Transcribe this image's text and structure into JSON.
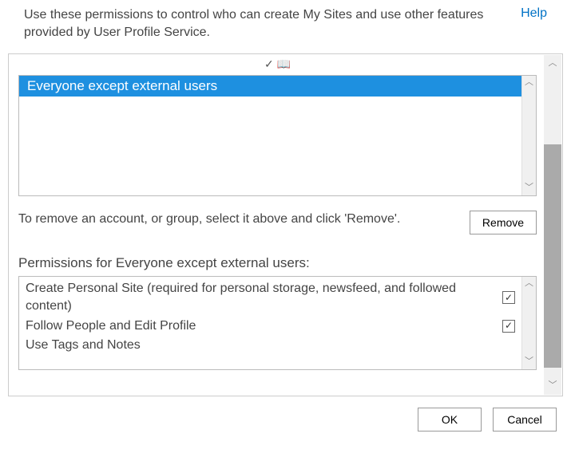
{
  "header": {
    "description": "Use these permissions to control who can create My Sites and use other features provided by User Profile Service.",
    "help_label": "Help"
  },
  "toolbar": {
    "icon1_name": "check-names-icon",
    "icon2_name": "browse-directory-icon"
  },
  "account_list": {
    "selected": "Everyone except external users"
  },
  "remove": {
    "instruction": "To remove an account, or group, select it above and click 'Remove'.",
    "button_label": "Remove"
  },
  "permissions": {
    "heading": "Permissions for Everyone except external users:",
    "items": [
      {
        "label": "Create Personal Site (required for personal storage, newsfeed, and followed content)",
        "checked": true
      },
      {
        "label": "Follow People and Edit Profile",
        "checked": true
      },
      {
        "label": "Use Tags and Notes",
        "checked": true
      }
    ]
  },
  "footer": {
    "ok_label": "OK",
    "cancel_label": "Cancel"
  }
}
